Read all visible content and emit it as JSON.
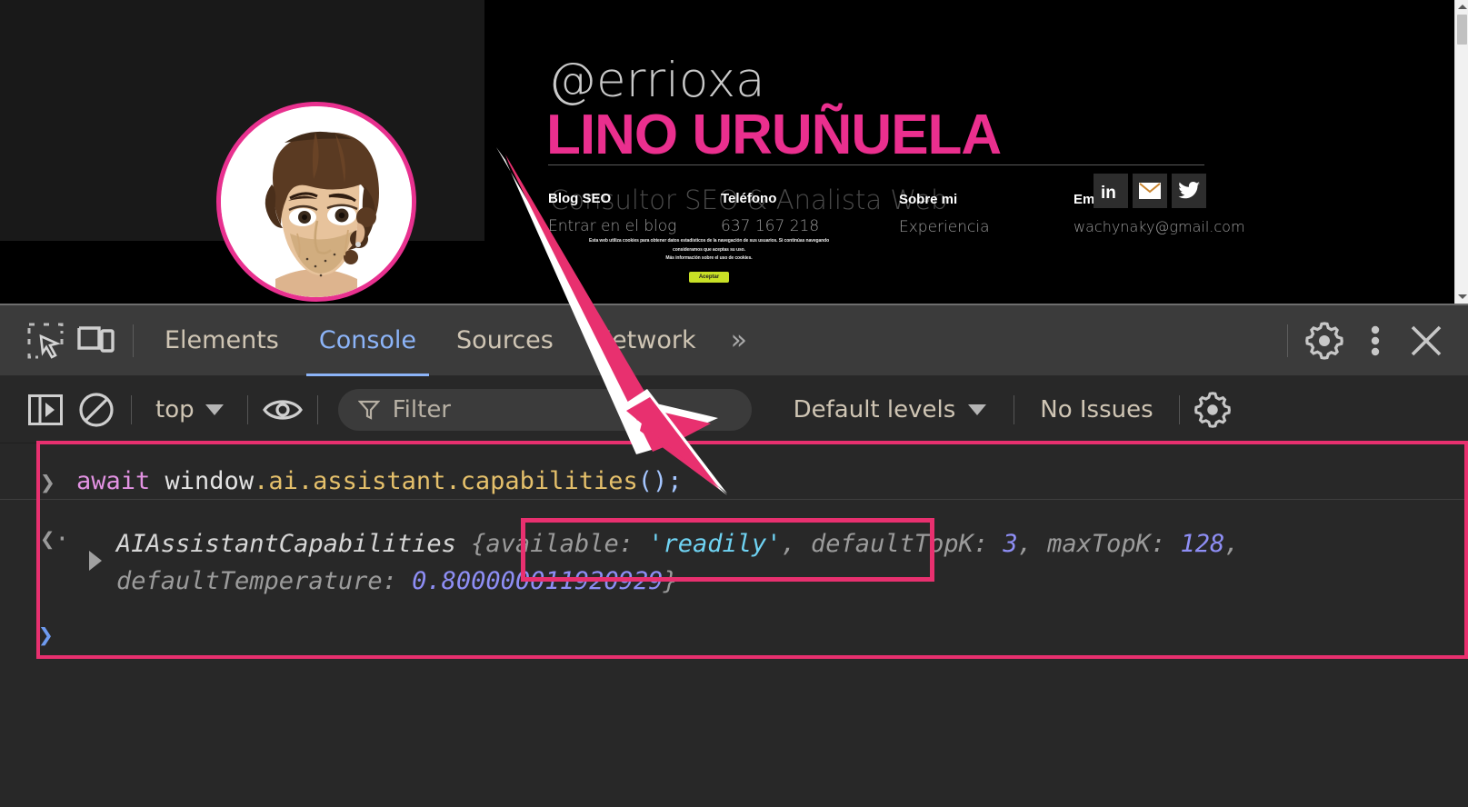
{
  "webpage": {
    "hero": {
      "handle": "@errioxa",
      "name": "LINO URUÑUELA",
      "subtitle": "Consultor SEO & Analista Web",
      "avatar_icon": "avatar-portrait",
      "accent_color": "#ea2f8e"
    },
    "nav_columns": [
      {
        "heading": "Blog SEO",
        "link": "Entrar en el blog"
      },
      {
        "heading": "Teléfono",
        "link": "637 167 218"
      },
      {
        "heading": "Sobre mi",
        "link": "Experiencia"
      },
      {
        "heading": "Email",
        "link": "wachynaky@gmail.com"
      }
    ],
    "social": [
      {
        "icon": "linkedin-icon",
        "label": "LinkedIn"
      },
      {
        "icon": "envelope-icon",
        "label": "Email"
      },
      {
        "icon": "twitter-icon",
        "label": "Twitter"
      }
    ],
    "cookie_banner": {
      "line1": "Esta web utiliza cookies para obtener datos estadísticos de la navegación de sus usuarios. Si continúas navegando consideramos que aceptas su uso.",
      "line2": "Más información sobre el uso de cookies.",
      "accept_label": "Aceptar",
      "accept_color": "#c8e026"
    },
    "scrollbar": {
      "up_icon": "triangle-up-icon",
      "down_icon": "triangle-down-icon"
    }
  },
  "devtools": {
    "left_icons": [
      {
        "icon": "inspect-element-icon",
        "label": "Inspect element"
      },
      {
        "icon": "device-toolbar-icon",
        "label": "Toggle device toolbar"
      }
    ],
    "tabs": [
      {
        "label": "Elements",
        "active": false
      },
      {
        "label": "Console",
        "active": true
      },
      {
        "label": "Sources",
        "active": false
      },
      {
        "label": "Network",
        "active": false
      }
    ],
    "more_tabs_label": "»",
    "right_icons": [
      {
        "icon": "gear-icon",
        "label": "Settings"
      },
      {
        "icon": "kebab-menu-icon",
        "label": "Customize and control DevTools"
      },
      {
        "icon": "close-icon",
        "label": "Close DevTools"
      }
    ],
    "active_tab_color": "#8cb4f8",
    "console_toolbar": {
      "sidebar_toggle_icon": "console-sidebar-icon",
      "clear_icon": "clear-console-icon",
      "context": "top",
      "context_caret_icon": "chevron-down-icon",
      "eye_icon": "live-expression-eye-icon",
      "filter_icon": "filter-funnel-icon",
      "filter_value": "",
      "filter_placeholder": "Filter",
      "levels": "Default levels",
      "levels_caret_icon": "chevron-down-icon",
      "issues": "No Issues",
      "settings_icon": "gear-icon"
    },
    "console": {
      "input_prompt_icon": "chevron-right-icon",
      "input_expression": "await window.ai.assistant.capabilities();",
      "input_tokens": {
        "keyword": "await",
        "object": " window",
        "prop1": ".ai.assistant.capabilities",
        "punct": "();"
      },
      "output_prompt_icon": "return-value-arrow-icon",
      "output_expand_icon": "expand-triangle-icon",
      "output_class": "AIAssistantCapabilities",
      "output_object": {
        "available": "'readily'",
        "defaultTopK": "3",
        "maxTopK": "128",
        "defaultTemperature": "0.800000011920929"
      },
      "output_raw": "AIAssistantCapabilities {available: 'readily', defaultTopK: 3, maxTopK: 128, defaultTemperature: 0.800000011920929}",
      "new_prompt_icon": "chevron-right-icon"
    },
    "annotations": {
      "arrow_color": "#e8306f",
      "highlight_color": "#e8306f",
      "arrow_icon": "pointer-arrow-annotation",
      "console_outline_name": "console-area-outline",
      "prop_highlight_name": "available-readily-highlight"
    }
  }
}
